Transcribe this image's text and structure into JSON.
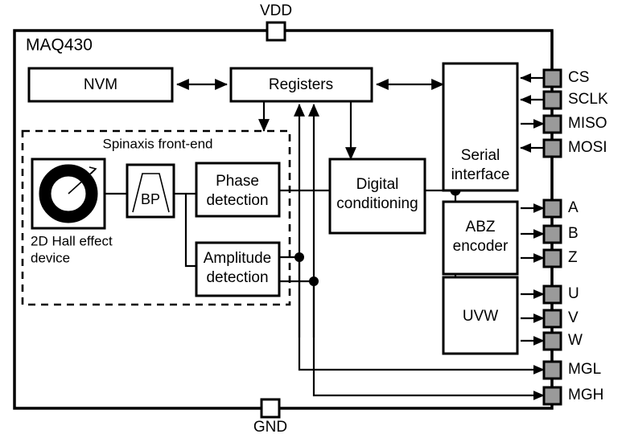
{
  "diagram": {
    "title": "MAQ430",
    "chip_label": "MAQ430",
    "group_label": "Spinaxis front-end",
    "colors": {
      "line": "#000000",
      "background": "#ffffff",
      "pin_fill": "#9a9a9a",
      "rail_pin_fill": "#ffffff"
    }
  },
  "blocks": [
    {
      "id": "nvm",
      "label": "NVM"
    },
    {
      "id": "registers",
      "label": "Registers"
    },
    {
      "id": "hall",
      "label_line1": "2D Hall effect",
      "label_line2": "device",
      "icon": "hall-sensor-icon"
    },
    {
      "id": "bp",
      "label": "BP",
      "icon": "bandpass-filter-icon"
    },
    {
      "id": "phase",
      "label_line1": "Phase",
      "label_line2": "detection"
    },
    {
      "id": "amplitude",
      "label_line1": "Amplitude",
      "label_line2": "detection"
    },
    {
      "id": "digital",
      "label_line1": "Digital",
      "label_line2": "conditioning"
    },
    {
      "id": "serial",
      "label_line1": "Serial",
      "label_line2": "interface"
    },
    {
      "id": "abz",
      "label_line1": "ABZ",
      "label_line2": "encoder"
    },
    {
      "id": "uvw",
      "label": "UVW"
    }
  ],
  "rails": [
    {
      "id": "vdd",
      "label": "VDD"
    },
    {
      "id": "gnd",
      "label": "GND"
    }
  ],
  "pins": [
    {
      "id": "cs",
      "label": "CS",
      "direction": "in"
    },
    {
      "id": "sclk",
      "label": "SCLK",
      "direction": "in"
    },
    {
      "id": "miso",
      "label": "MISO",
      "direction": "out"
    },
    {
      "id": "mosi",
      "label": "MOSI",
      "direction": "in"
    },
    {
      "id": "a",
      "label": "A",
      "direction": "out"
    },
    {
      "id": "b",
      "label": "B",
      "direction": "out"
    },
    {
      "id": "z",
      "label": "Z",
      "direction": "out"
    },
    {
      "id": "u",
      "label": "U",
      "direction": "out"
    },
    {
      "id": "v",
      "label": "V",
      "direction": "out"
    },
    {
      "id": "w",
      "label": "W",
      "direction": "out"
    },
    {
      "id": "mgl",
      "label": "MGL",
      "direction": "out"
    },
    {
      "id": "mgh",
      "label": "MGH",
      "direction": "out"
    }
  ]
}
